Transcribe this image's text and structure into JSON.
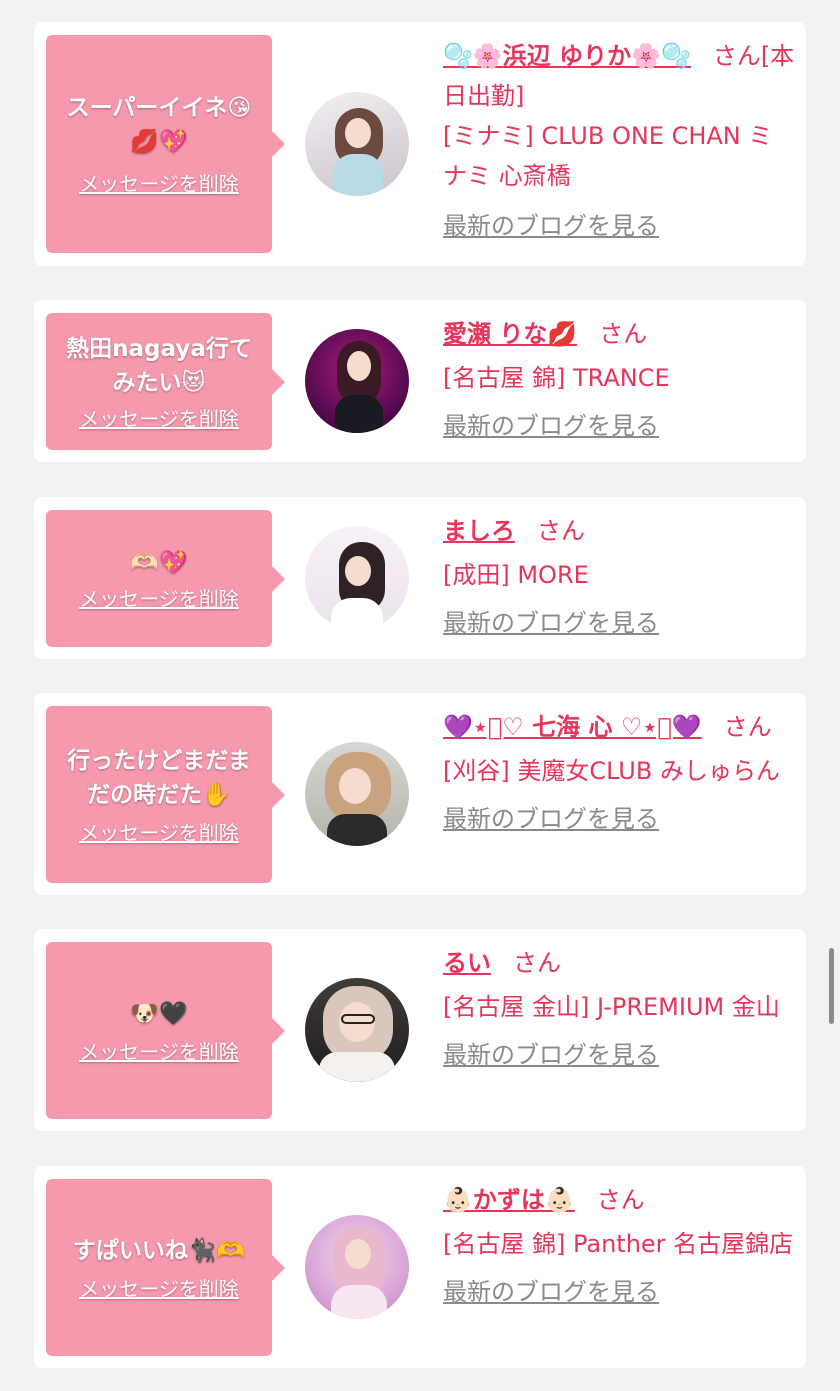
{
  "delete_label": "メッセージを削除",
  "blog_label": "最新のブログを見る",
  "san_label": "さん",
  "cards": [
    {
      "message": "スーパーイイネ😘💋💖",
      "name": "🫧🌸浜辺 ゆりか🌸🫧",
      "shop": "[本日出勤]",
      "shop2": "[ミナミ] CLUB ONE CHAN ミナミ 心斎橋"
    },
    {
      "message": "熱田nagaya行てみたい😻",
      "name": "愛瀬 りな💋",
      "shop": "[名古屋 錦] TRANCE",
      "shop2": ""
    },
    {
      "message": "🫶🏻💖",
      "name": "ましろ",
      "shop": "[成田] MORE",
      "shop2": ""
    },
    {
      "message": "行ったけどまだまだの時だた✋",
      "name": "💜⋆͛♡ 七海 心 ♡⋆͛💜",
      "shop": "[刈谷] 美魔女CLUB みしゅらん",
      "shop2": ""
    },
    {
      "message": "🐶🖤",
      "name": "るい",
      "shop": "[名古屋 金山] J-PREMIUM 金山",
      "shop2": ""
    },
    {
      "message": "すぱいいね🐈‍⬛🫶",
      "name": "👶🏻かずは👶🏻",
      "shop": "[名古屋 錦] Panther 名古屋錦店",
      "shop2": ""
    }
  ]
}
